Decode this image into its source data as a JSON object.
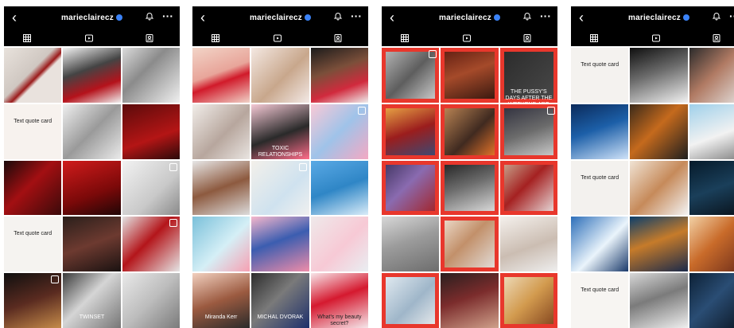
{
  "profiles": [
    {
      "handle": "marieclairecz",
      "back_icon": "chevron-left-icon",
      "bell_icon": "bell-icon",
      "more_icon": "more-icon",
      "tabs": [
        {
          "name": "grid-icon"
        },
        {
          "name": "reels-icon"
        },
        {
          "name": "tagged-icon"
        }
      ],
      "tiles": [
        {
          "bg": "linear-gradient(135deg,#e8e2dc 0%,#cfc7c1 45%,#9b1b1b 55%,#e9e2dd 60%)",
          "cap": ""
        },
        {
          "bg": "linear-gradient(160deg,#f2f2f2 0%,#444 40%,#b5121b 70%,#f0f0f0 100%)",
          "cap": ""
        },
        {
          "bg": "linear-gradient(135deg,#dadada 0%,#8b8b8b 40%,#f0f0f0 100%)",
          "cap": ""
        },
        {
          "bg": "#f7f2ee",
          "cap": "Text quote card"
        },
        {
          "bg": "linear-gradient(135deg,#efefef 0%,#9a9a9a 50%,#eaeaea 100%)",
          "cap": ""
        },
        {
          "bg": "linear-gradient(160deg,#5b0b0b 0%,#b41515 60%,#2b0a0a 100%)",
          "cap": ""
        },
        {
          "bg": "linear-gradient(135deg,#1a0a0a 0%,#a30f12 45%,#3b0a0a 100%)",
          "cap": ""
        },
        {
          "bg": "linear-gradient(160deg,#d01b1b 0%,#7b0909 60%,#200606 100%)",
          "cap": ""
        },
        {
          "bg": "linear-gradient(135deg,#f2f2f2 0%,#c9c9c9 60%,#8a8a8a 100%)",
          "cap": ""
        },
        {
          "bg": "#f5f3f0",
          "cap": "Text quote card"
        },
        {
          "bg": "linear-gradient(160deg,#2a1f1b 0%,#6d3a30 50%,#1a1211 100%)",
          "cap": ""
        },
        {
          "bg": "linear-gradient(135deg,#e3e3e3 0%,#b4151a 45%,#e5e5e5 100%)",
          "cap": ""
        },
        {
          "bg": "linear-gradient(160deg,#0f0f0f 0%,#5a2b20 50%,#c58b4a 100%)",
          "cap": ""
        },
        {
          "bg": "linear-gradient(135deg,#3a3a3a 0%,#d5d5d5 45%,#777 100%)",
          "cap": "TWINSET"
        },
        {
          "bg": "linear-gradient(135deg,#e9e9e9 0%,#bdbdbd 50%,#7b7b7b 100%)",
          "cap": ""
        }
      ]
    },
    {
      "handle": "marieclairecz",
      "back_icon": "chevron-left-icon",
      "bell_icon": "bell-icon",
      "more_icon": "more-icon",
      "tabs": [
        {
          "name": "grid-icon"
        },
        {
          "name": "reels-icon"
        },
        {
          "name": "tagged-icon"
        }
      ],
      "tiles": [
        {
          "bg": "linear-gradient(160deg,#f2d4c7 0%,#e8a59a 45%,#d11a2a 60%,#f0d3c8 100%)",
          "cap": ""
        },
        {
          "bg": "linear-gradient(135deg,#f4e8e2 0%,#c8a78c 55%,#f3e9e6 100%)",
          "cap": ""
        },
        {
          "bg": "linear-gradient(160deg,#1b1b1b 0%,#7b4f3a 40%,#d12a3d 70%,#eee 100%)",
          "cap": ""
        },
        {
          "bg": "linear-gradient(135deg,#f1ede9 0%,#b7a69d 55%,#e9e5e1 100%)",
          "cap": ""
        },
        {
          "bg": "linear-gradient(160deg,#f5c9d5 0%,#2a2a2a 55%,#ff6c8a 100%)",
          "cap": "TOXIC RELATIONSHIPS"
        },
        {
          "bg": "linear-gradient(135deg,#f9c9d6 0%,#9fc3e9 50%,#f4a9c3 100%)",
          "cap": ""
        },
        {
          "bg": "linear-gradient(160deg,#e7e7e7 0%,#8d5a3f 50%,#dcdcdc 100%)",
          "cap": ""
        },
        {
          "bg": "linear-gradient(135deg,#f3f0ea 0%,#cfe2ef 60%,#f0f0ef 100%)",
          "cap": ""
        },
        {
          "bg": "linear-gradient(160deg,#5aa9e5 0%,#2f86c6 50%,#d9ecf8 100%)",
          "cap": ""
        },
        {
          "bg": "linear-gradient(135deg,#7ac0da 0%,#d5eff6 55%,#f6a0b2 100%)",
          "cap": ""
        },
        {
          "bg": "linear-gradient(160deg,#f6b7cc 0%,#3b5db0 45%,#ef8ca9 100%)",
          "cap": ""
        },
        {
          "bg": "linear-gradient(135deg,#efe9ea 0%,#f7c9d5 55%,#e9eef2 100%)",
          "cap": ""
        },
        {
          "bg": "linear-gradient(160deg,#f2d0bf 0%,#9b5a40 50%,#2b2b2b 100%)",
          "cap": "Miranda Kerr"
        },
        {
          "bg": "linear-gradient(135deg,#2c2c2c 0%,#7a7a7a 45%,#1d2f6b 100%)",
          "cap": "MICHAL DVORAK"
        },
        {
          "bg": "linear-gradient(160deg,#f7e4e8 0%,#d5192f 45%,#f5e6ea 100%)",
          "cap": "What's my beauty secret?"
        }
      ]
    },
    {
      "handle": "marieclairecz",
      "back_icon": "chevron-left-icon",
      "bell_icon": "bell-icon",
      "more_icon": "more-icon",
      "tabs": [
        {
          "name": "grid-icon"
        },
        {
          "name": "reels-icon"
        },
        {
          "name": "tagged-icon"
        }
      ],
      "tiles": [
        {
          "bg": "linear-gradient(135deg,#bfbfbf 0%,#5e5e5e 50%,#d9d9d9 100%)",
          "cap": "",
          "frame": true
        },
        {
          "bg": "linear-gradient(160deg,#5a1a10 0%,#a54a2a 45%,#2b120c 100%)",
          "cap": "",
          "frame": true
        },
        {
          "bg": "linear-gradient(135deg,#2a2a2a 0%,#4a4a4a 100%)",
          "cap": "THE PUSSY'S DAYS AFTER THE WEEKEND ARE THE HARDEST",
          "frame": true
        },
        {
          "bg": "linear-gradient(160deg,#f2b54a 0%,#9b1d1d 50%,#2f4f7f 100%)",
          "cap": "",
          "frame": true
        },
        {
          "bg": "linear-gradient(135deg,#c98f5a 0%,#402a20 55%,#ff7f2a 100%)",
          "cap": "",
          "frame": true
        },
        {
          "bg": "linear-gradient(160deg,#2b2b3a 0%,#6b6b6b 50%,#d7d7d7 100%)",
          "cap": "",
          "frame": true
        },
        {
          "bg": "linear-gradient(135deg,#3a2f5a 0%,#8a6bb0 45%,#a51d1d 100%)",
          "cap": "",
          "frame": true
        },
        {
          "bg": "linear-gradient(160deg,#1b1b1b 0%,#6c6c6c 45%,#e8e8e8 100%)",
          "cap": "",
          "frame": true
        },
        {
          "bg": "linear-gradient(135deg,#cbb49a 0%,#a52121 45%,#eee 100%)",
          "cap": "",
          "frame": true
        },
        {
          "bg": "linear-gradient(160deg,#d7d7d7 0%,#9c9c9c 45%,#6d6d6d 100%)",
          "cap": ""
        },
        {
          "bg": "linear-gradient(135deg,#f1e3d6 0%,#c2906a 45%,#e6e6e6 100%)",
          "cap": "",
          "frame": true
        },
        {
          "bg": "linear-gradient(160deg,#f4f0ec 0%,#cbbdb2 55%,#eee 100%)",
          "cap": ""
        },
        {
          "bg": "linear-gradient(135deg,#e9f0f5 0%,#9fb6c9 55%,#f0f0f0 100%)",
          "cap": "",
          "frame": true
        },
        {
          "bg": "linear-gradient(160deg,#2a1f1f 0%,#7b2c2c 45%,#cfa08a 100%)",
          "cap": ""
        },
        {
          "bg": "linear-gradient(135deg,#f0e2c6 0%,#d29a4e 50%,#7c3d1a 100%)",
          "cap": "",
          "frame": true
        }
      ]
    },
    {
      "handle": "marieclairecz",
      "back_icon": "chevron-left-icon",
      "bell_icon": "bell-icon",
      "more_icon": "more-icon",
      "tabs": [
        {
          "name": "grid-icon"
        },
        {
          "name": "reels-icon"
        },
        {
          "name": "tagged-icon"
        }
      ],
      "tiles": [
        {
          "bg": "#f4f2ef",
          "cap": "Text quote card"
        },
        {
          "bg": "linear-gradient(160deg,#0f0f0f 0%,#6b6b6b 45%,#f2f2f2 100%)",
          "cap": ""
        },
        {
          "bg": "linear-gradient(135deg,#2b2b2b 0%,#b07a63 45%,#e7e7e7 100%)",
          "cap": ""
        },
        {
          "bg": "linear-gradient(160deg,#0b2a5a 0%,#1c5fa8 45%,#cfe2f8 100%)",
          "cap": ""
        },
        {
          "bg": "linear-gradient(135deg,#3a2a1a 0%,#c56a1d 45%,#1e1e1e 100%)",
          "cap": ""
        },
        {
          "bg": "linear-gradient(160deg,#9fd0ea 0%,#f2f2f2 55%,#7f7f7f 100%)",
          "cap": ""
        },
        {
          "bg": "#f3f1ee",
          "cap": "Text quote card"
        },
        {
          "bg": "linear-gradient(135deg,#f0e3d4 0%,#c68a5a 50%,#f3f3f3 100%)",
          "cap": ""
        },
        {
          "bg": "linear-gradient(160deg,#061a2a 0%,#1a3f5a 50%,#081018 100%)",
          "cap": ""
        },
        {
          "bg": "linear-gradient(135deg,#2d6fb9 0%,#eaf4fb 55%,#1a3a6b 100%)",
          "cap": ""
        },
        {
          "bg": "linear-gradient(160deg,#0b3e6b 0%,#c67b2a 45%,#1b2a4a 100%)",
          "cap": ""
        },
        {
          "bg": "linear-gradient(135deg,#f2d1a6 0%,#c96b2a 45%,#6a2b1a 100%)",
          "cap": ""
        },
        {
          "bg": "#f7f5f2",
          "cap": "Text quote card"
        },
        {
          "bg": "linear-gradient(160deg,#d7d7d7 0%,#7b7b7b 45%,#efefef 100%)",
          "cap": ""
        },
        {
          "bg": "linear-gradient(135deg,#0d2136 0%,#2a4d74 45%,#0a1420 100%)",
          "cap": ""
        }
      ]
    }
  ]
}
